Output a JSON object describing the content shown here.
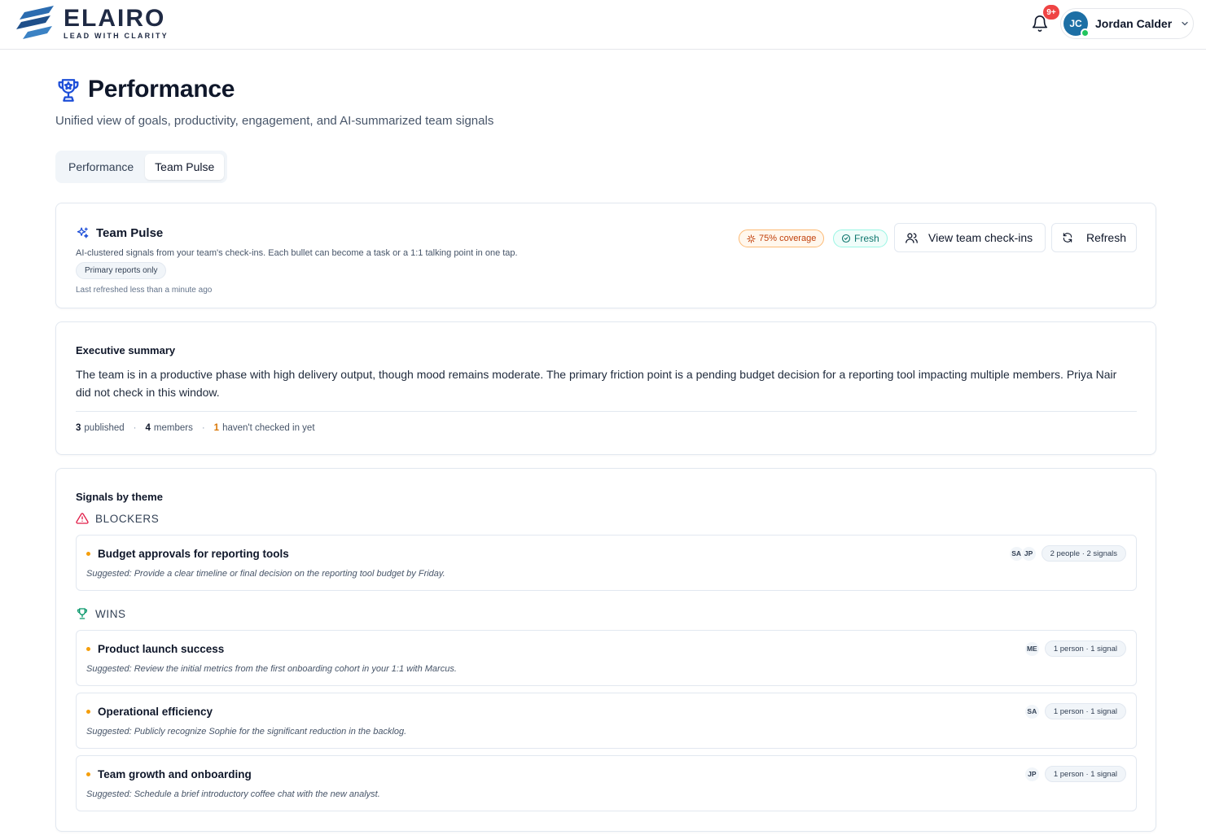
{
  "app": {
    "logo_name": "ELAIRO",
    "logo_tagline": "LEAD WITH CLARITY",
    "notification_badge": "9+",
    "user": {
      "initials": "JC",
      "name": "Jordan Calder"
    }
  },
  "header": {
    "title": "Performance",
    "subtitle": "Unified view of goals, productivity, engagement, and AI-summarized team signals",
    "tabs": [
      {
        "label": "Performance",
        "active": false
      },
      {
        "label": "Team Pulse",
        "active": true
      }
    ]
  },
  "pulse": {
    "title": "Team Pulse",
    "description": "AI-clustered signals from your team's check-ins. Each bullet can become a task or a 1:1 talking point in one tap.",
    "filter_pill": "Primary reports only",
    "last_refreshed": "Last refreshed less than a minute ago",
    "coverage_badge": "75% coverage",
    "fresh_badge": "Fresh",
    "view_button": "View team check-ins",
    "refresh_button": "Refresh"
  },
  "executive_summary": {
    "title": "Executive summary",
    "body": "The team is in a productive phase with high delivery output, though mood remains moderate. The primary friction point is a pending budget decision for a reporting tool impacting multiple members. Priya Nair did not check in this window.",
    "stats": {
      "published_count": "3",
      "published_label": "published",
      "members_count": "4",
      "members_label": "members",
      "missing_count": "1",
      "missing_label": "haven't checked in yet"
    }
  },
  "signals": {
    "title": "Signals by theme",
    "themes": [
      {
        "name": "BLOCKERS",
        "items": [
          {
            "title": "Budget approvals for reporting tools",
            "suggestion": "Suggested: Provide a clear timeline or final decision on the reporting tool budget by Friday.",
            "people": [
              "SA",
              "JP"
            ],
            "count": "2 people · 2 signals"
          }
        ]
      },
      {
        "name": "WINS",
        "items": [
          {
            "title": "Product launch success",
            "suggestion": "Suggested: Review the initial metrics from the first onboarding cohort in your 1:1 with Marcus.",
            "people": [
              "ME"
            ],
            "count": "1 person · 1 signal"
          },
          {
            "title": "Operational efficiency",
            "suggestion": "Suggested: Publicly recognize Sophie for the significant reduction in the backlog.",
            "people": [
              "SA"
            ],
            "count": "1 person · 1 signal"
          },
          {
            "title": "Team growth and onboarding",
            "suggestion": "Suggested: Schedule a brief introductory coffee chat with the new analyst.",
            "people": [
              "JP"
            ],
            "count": "1 person · 1 signal"
          }
        ]
      }
    ]
  },
  "colors": {
    "brand": "#1f2a44",
    "accent_blue": "#1d6fa5",
    "warning": "#f59e0b",
    "danger": "#e11d48",
    "success": "#059669"
  }
}
